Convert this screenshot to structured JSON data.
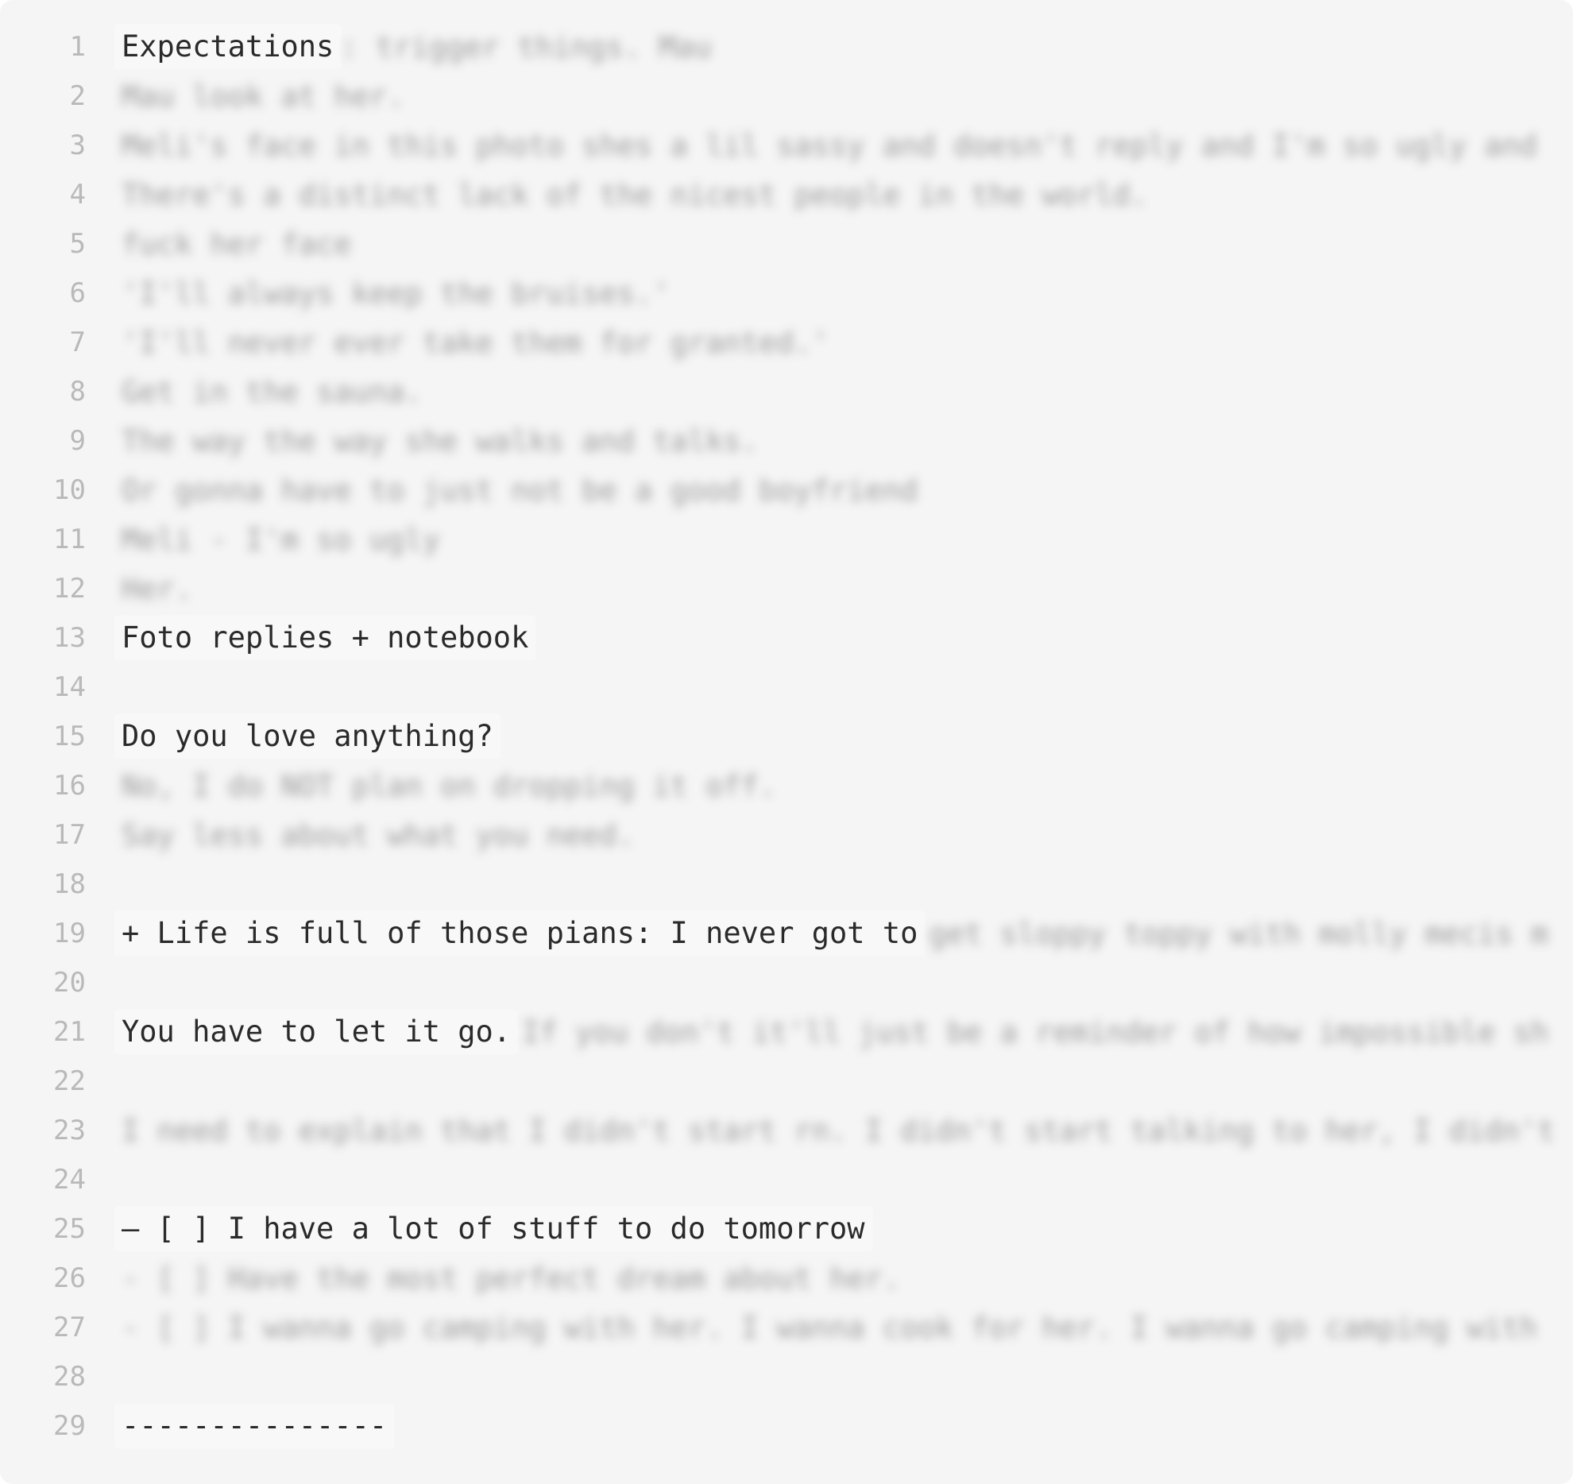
{
  "editor": {
    "lines": [
      {
        "num": "1",
        "text": "Expectations",
        "blurred": ": trigger things. Mau"
      },
      {
        "num": "2",
        "text": "",
        "blurred": "Mau look at her."
      },
      {
        "num": "3",
        "text": "",
        "blurred": "Meli's face in this photo shes a lil sassy and doesn't reply and I'm so ugly and"
      },
      {
        "num": "4",
        "text": "",
        "blurred": "There's a distinct lack of the nicest people in the world."
      },
      {
        "num": "5",
        "text": "",
        "blurred": "fuck her face"
      },
      {
        "num": "6",
        "text": "",
        "blurred": "'I'll always keep the bruises.'"
      },
      {
        "num": "7",
        "text": "",
        "blurred": "'I'll never ever take them for granted.'"
      },
      {
        "num": "8",
        "text": "",
        "blurred": "Get in the sauna."
      },
      {
        "num": "9",
        "text": "",
        "blurred": "The way the way she walks and talks."
      },
      {
        "num": "10",
        "text": "",
        "blurred": "Or gonna have to just not be a good boyfriend"
      },
      {
        "num": "11",
        "text": "",
        "blurred": "Meli - I'm so ugly"
      },
      {
        "num": "12",
        "text": "",
        "blurred": "Her."
      },
      {
        "num": "13",
        "text": "Foto replies + notebook",
        "blurred": ""
      },
      {
        "num": "14",
        "text": "",
        "blurred": ""
      },
      {
        "num": "15",
        "text": "Do you love anything?",
        "blurred": ""
      },
      {
        "num": "16",
        "text": "",
        "blurred": "No, I do NOT plan on dropping it off."
      },
      {
        "num": "17",
        "text": "",
        "blurred": "Say less about what you need."
      },
      {
        "num": "18",
        "text": "",
        "blurred": ""
      },
      {
        "num": "19",
        "text": "+ Life is full of those pians: I never got to",
        "blurred": "get sloppy toppy with molly mecis m"
      },
      {
        "num": "20",
        "text": "",
        "blurred": ""
      },
      {
        "num": "21",
        "text": "You have to let it go.",
        "blurred": "If you don't it'll just be a reminder of how impossible sh"
      },
      {
        "num": "22",
        "text": "",
        "blurred": ""
      },
      {
        "num": "23",
        "text": "",
        "blurred": "I need to explain that I didn't start rn. I didn't start talking to her, I didn't"
      },
      {
        "num": "24",
        "text": "",
        "blurred": ""
      },
      {
        "num": "25",
        "text": "– [ ] I have a lot of stuff to do tomorrow",
        "blurred": ""
      },
      {
        "num": "26",
        "text": "",
        "blurred": "- [ ] Have the most perfect dream about her."
      },
      {
        "num": "27",
        "text": "",
        "blurred": "- [ ] I wanna go camping with her. I wanna cook for her. I wanna go camping with"
      },
      {
        "num": "28",
        "text": "",
        "blurred": ""
      },
      {
        "num": "29",
        "text": "---------------",
        "blurred": ""
      }
    ]
  }
}
